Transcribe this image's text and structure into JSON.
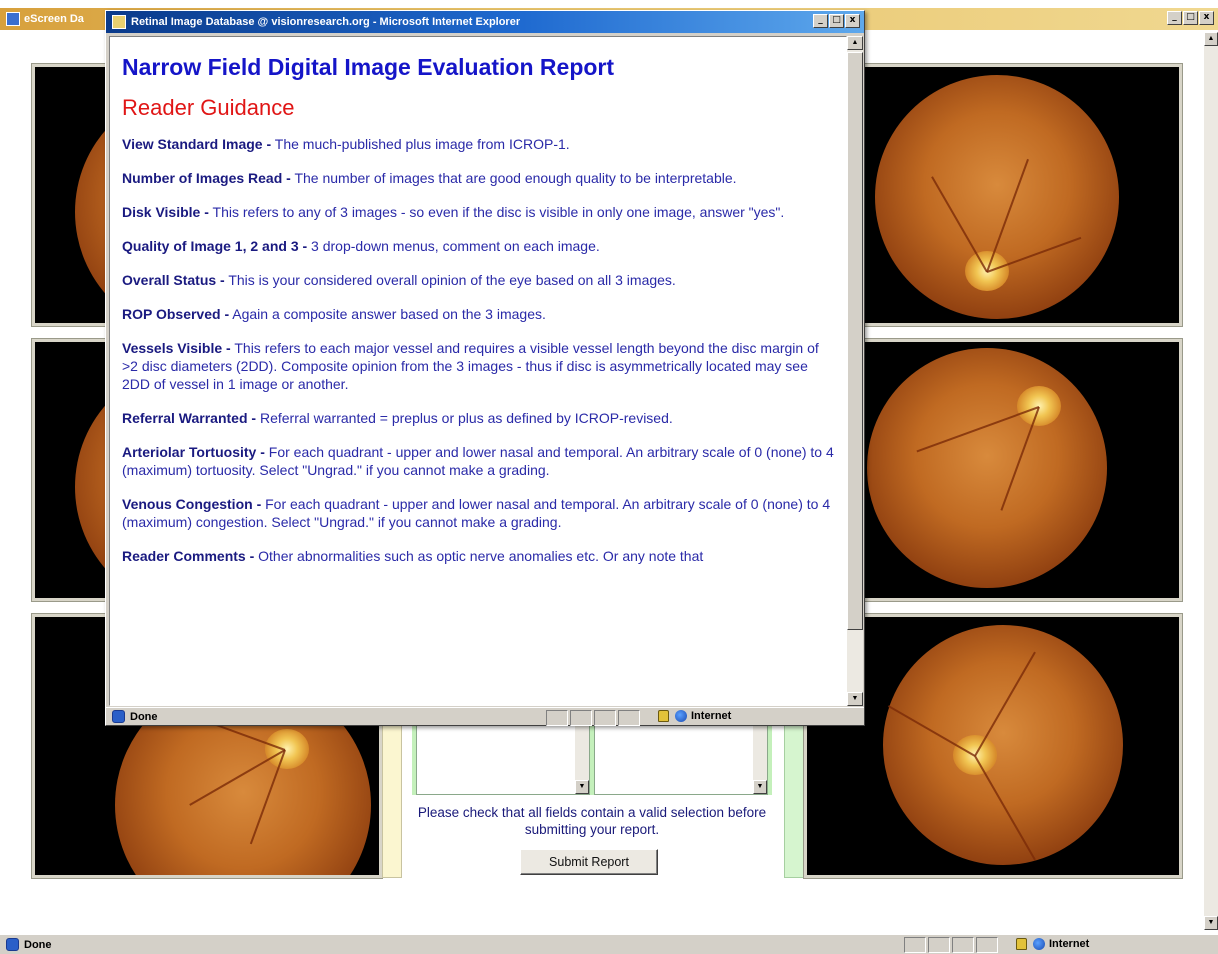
{
  "background_window": {
    "title": "eScreen Da",
    "status": {
      "text": "Done",
      "zone": "Internet"
    },
    "form": {
      "validate_note": "Please check that all fields contain a valid selection before submitting your report.",
      "submit_label": "Submit Report"
    }
  },
  "popup_window": {
    "title": "Retinal Image Database @ visionresearch.org - Microsoft Internet Explorer",
    "status": {
      "text": "Done",
      "zone": "Internet"
    },
    "document": {
      "title": "Narrow Field Digital Image Evaluation Report",
      "subtitle": "Reader Guidance",
      "items": [
        {
          "term": "View Standard Image -",
          "text": " The much-published plus image from ICROP-1."
        },
        {
          "term": "Number of Images Read -",
          "text": " The number of images that are good enough quality to be interpretable."
        },
        {
          "term": "Disk Visible -",
          "text": " This refers to any of 3 images - so even if the disc is visible in only one image, answer \"yes\"."
        },
        {
          "term": "Quality of Image 1, 2 and 3 -",
          "text": " 3 drop-down menus, comment on each image."
        },
        {
          "term": "Overall Status -",
          "text": " This is your considered overall opinion of the eye based on all 3 images."
        },
        {
          "term": "ROP Observed -",
          "text": " Again a composite answer based on the 3 images."
        },
        {
          "term": "Vessels Visible -",
          "text": " This refers to each major vessel and requires a visible vessel length beyond the disc margin of >2 disc diameters (2DD). Composite opinion from the 3 images - thus if disc is asymmetrically located may see 2DD of vessel in 1 image or another."
        },
        {
          "term": "Referral Warranted -",
          "text": " Referral warranted = preplus or plus as defined by ICROP-revised."
        },
        {
          "term": "Arteriolar Tortuosity -",
          "text": " For each quadrant - upper and lower nasal and temporal. An arbitrary scale of 0 (none) to 4 (maximum) tortuosity. Select \"Ungrad.\" if you cannot make a grading."
        },
        {
          "term": "Venous Congestion -",
          "text": " For each quadrant - upper and lower nasal and temporal. An arbitrary scale of 0 (none) to 4 (maximum) congestion. Select \"Ungrad.\" if you cannot make a grading."
        },
        {
          "term": "Reader Comments -",
          "text": " Other abnormalities such as optic nerve anomalies etc. Or any note that"
        }
      ]
    }
  },
  "window_buttons": {
    "minimize": "_",
    "maximize": "□",
    "close": "x"
  },
  "icons": [
    "ie-icon",
    "lock-icon",
    "globe-icon",
    "scroll-up-icon",
    "scroll-down-icon"
  ],
  "colors": {
    "doc_title": "#1515c8",
    "doc_subtitle": "#e01515",
    "popup_titlebar": "#0a3a8a",
    "bg_titlebar": "#d7a03c"
  }
}
